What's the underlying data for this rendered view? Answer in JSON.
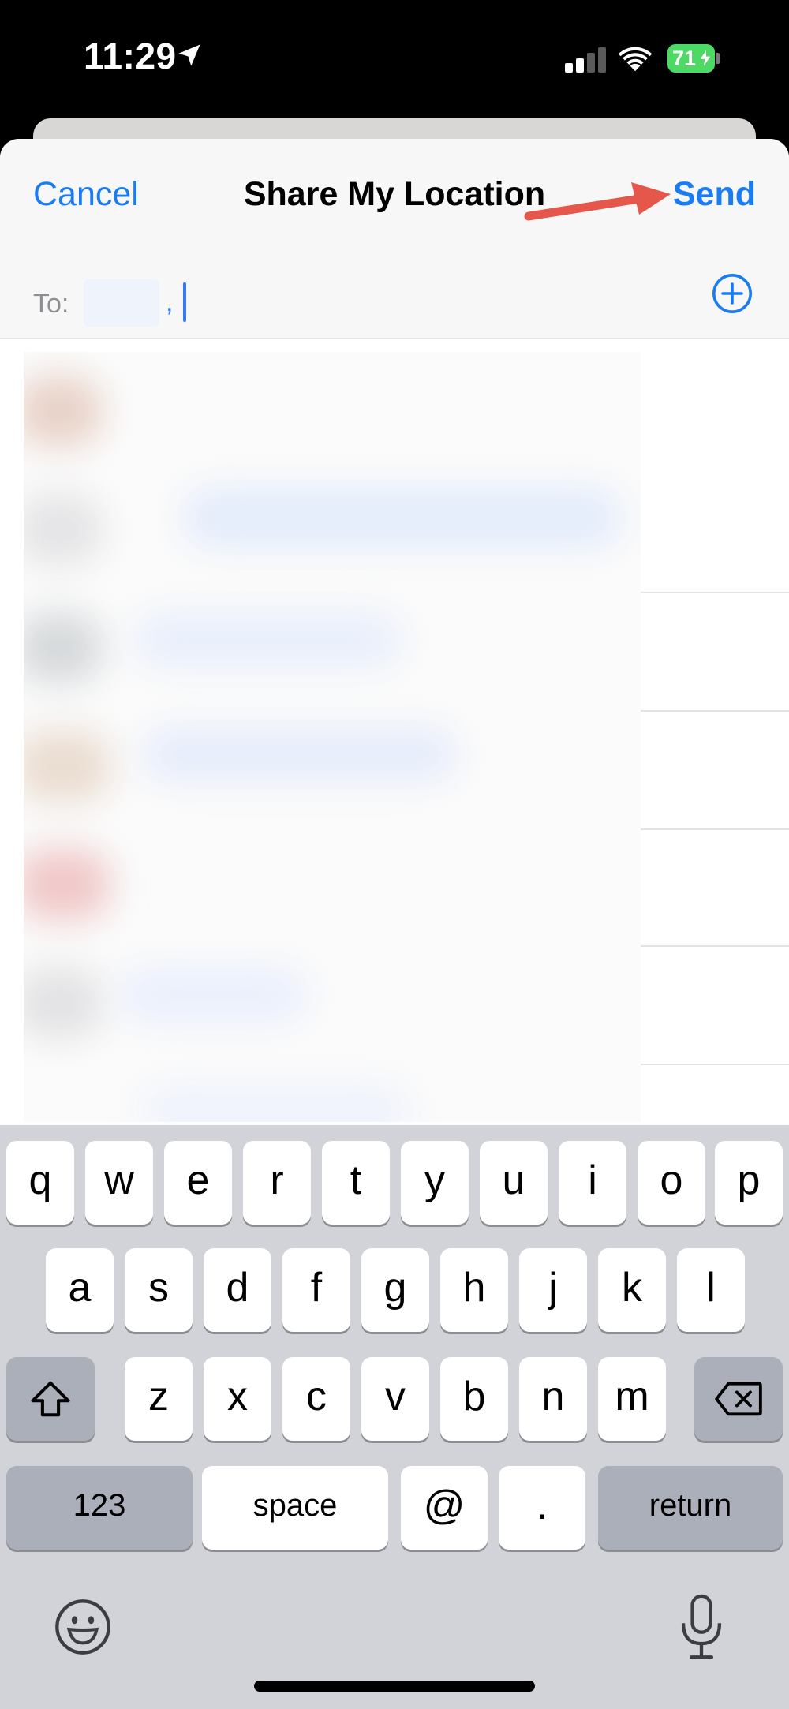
{
  "status_bar": {
    "time": "11:29",
    "battery_percent": "71",
    "icons": [
      "location-arrow-icon",
      "cellular-signal-icon",
      "wifi-icon",
      "battery-icon"
    ]
  },
  "sheet": {
    "cancel_label": "Cancel",
    "title": "Share My Location",
    "send_label": "Send",
    "to_label": "To:",
    "recipient_separator": ","
  },
  "keyboard": {
    "rows": [
      [
        "q",
        "w",
        "e",
        "r",
        "t",
        "y",
        "u",
        "i",
        "o",
        "p"
      ],
      [
        "a",
        "s",
        "d",
        "f",
        "g",
        "h",
        "j",
        "k",
        "l"
      ],
      [
        "z",
        "x",
        "c",
        "v",
        "b",
        "n",
        "m"
      ]
    ],
    "numbers_label": "123",
    "space_label": "space",
    "at_label": "@",
    "dot_label": ".",
    "return_label": "return"
  },
  "colors": {
    "accent": "#1a7cf5",
    "annotation_arrow": "#e5574a",
    "battery": "#4cd964"
  }
}
